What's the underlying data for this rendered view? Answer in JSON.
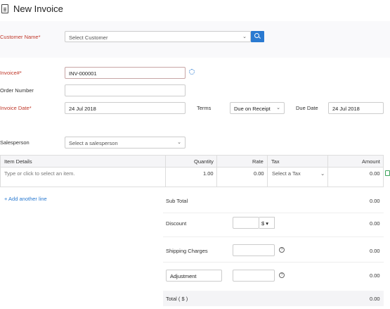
{
  "header": {
    "title": "New Invoice",
    "icon": "document-icon"
  },
  "customer": {
    "label": "Customer Name*",
    "placeholder": "Select Customer",
    "caret": "⌄",
    "search_icon": "search-icon",
    "accent": "#2a7ad1"
  },
  "invoice": {
    "number_label": "Invoice#*",
    "number_value": "INV-000001",
    "order_label": "Order Number",
    "order_value": "",
    "date_label": "Invoice Date*",
    "date_value": "24 Jul 2018",
    "terms_label": "Terms",
    "terms_value": "Due on Receipt",
    "due_label": "Due Date",
    "due_value": "24 Jul 2018"
  },
  "salesperson": {
    "label": "Salesperson",
    "placeholder": "Select a salesperson"
  },
  "items_table": {
    "headers": [
      "Item Details",
      "Quantity",
      "Rate",
      "Tax",
      "Amount"
    ],
    "rows": [
      {
        "item": "Type or click to select an item.",
        "quantity": "1.00",
        "rate": "0.00",
        "tax": "Select a Tax",
        "amount": "0.00"
      }
    ],
    "add_line": "+ Add another line"
  },
  "totals": {
    "sub_total_label": "Sub Total",
    "sub_total_value": "0.00",
    "discount_label": "Discount",
    "discount_value": "0.00",
    "discount_unit": "$ ▾",
    "shipping_label": "Shipping Charges",
    "shipping_value": "0.00",
    "adjustment_label": "Adjustment",
    "adjustment_value": "0.00",
    "total_label": "Total ( $ )",
    "total_value": "0.00"
  }
}
